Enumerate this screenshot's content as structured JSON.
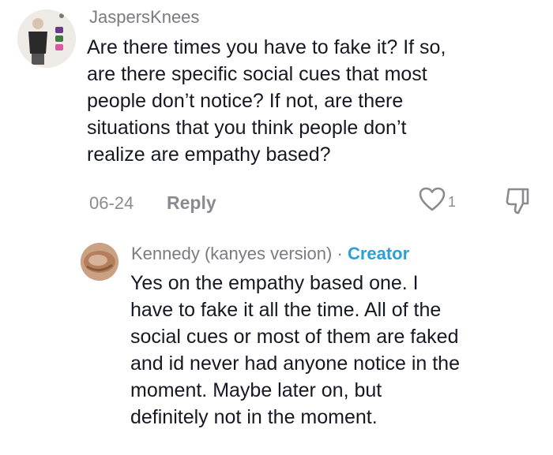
{
  "comment1": {
    "username": "JaspersKnees",
    "lines": [
      "Are there times you have to fake it? If so,",
      "are there specific social cues that most",
      "people don’t notice? If not, are there",
      "situations that you think people don’t",
      "realize are empathy based?"
    ],
    "date": "06-24",
    "reply_label": "Reply",
    "like_count": "1"
  },
  "comment2": {
    "username": "Kennedy (kanyes version)",
    "separator": "·",
    "creator_label": "Creator",
    "lines": [
      "Yes on the empathy based one. I",
      "have to fake it all the time. All of the",
      "social cues or most of them are faked",
      "and id never had anyone notice in the",
      "moment. Maybe later on, but",
      "definitely not in the moment."
    ]
  },
  "colors": {
    "text": "#161823",
    "muted": "#8a8b91",
    "creator": "#2b9fd6"
  }
}
